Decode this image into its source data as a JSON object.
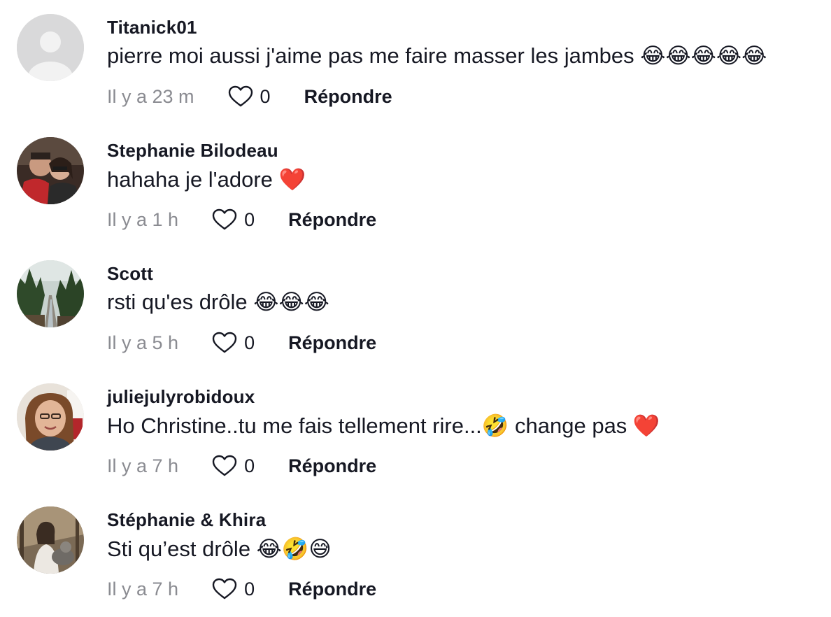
{
  "comments": [
    {
      "username": "Titanick01",
      "text": "pierre moi aussi j'aime pas me faire masser les jambes 😂😂😂😂😂",
      "time": "Il y a 23 m",
      "likes": "0",
      "reply_label": "Répondre",
      "avatar": "default-avatar-icon"
    },
    {
      "username": "Stephanie Bilodeau",
      "text": "hahaha je l'adore ❤️",
      "time": "Il y a 1 h",
      "likes": "0",
      "reply_label": "Répondre",
      "avatar": "couple-photo"
    },
    {
      "username": "Scott",
      "text": "rsti qu'es drôle 😂😂😂",
      "time": "Il y a 5 h",
      "likes": "0",
      "reply_label": "Répondre",
      "avatar": "forest-stream-photo"
    },
    {
      "username": "juliejulyrobidoux",
      "text": "Ho Christine..tu me fais tellement rire...🤣 change pas ❤️",
      "time": "Il y a 7 h",
      "likes": "0",
      "reply_label": "Répondre",
      "avatar": "woman-portrait-photo"
    },
    {
      "username": "Stéphanie & Khira",
      "text": "Sti qu’est drôle 😂🤣😅",
      "time": "Il y a 7 h",
      "likes": "0",
      "reply_label": "Répondre",
      "avatar": "woman-with-dog-photo"
    }
  ]
}
